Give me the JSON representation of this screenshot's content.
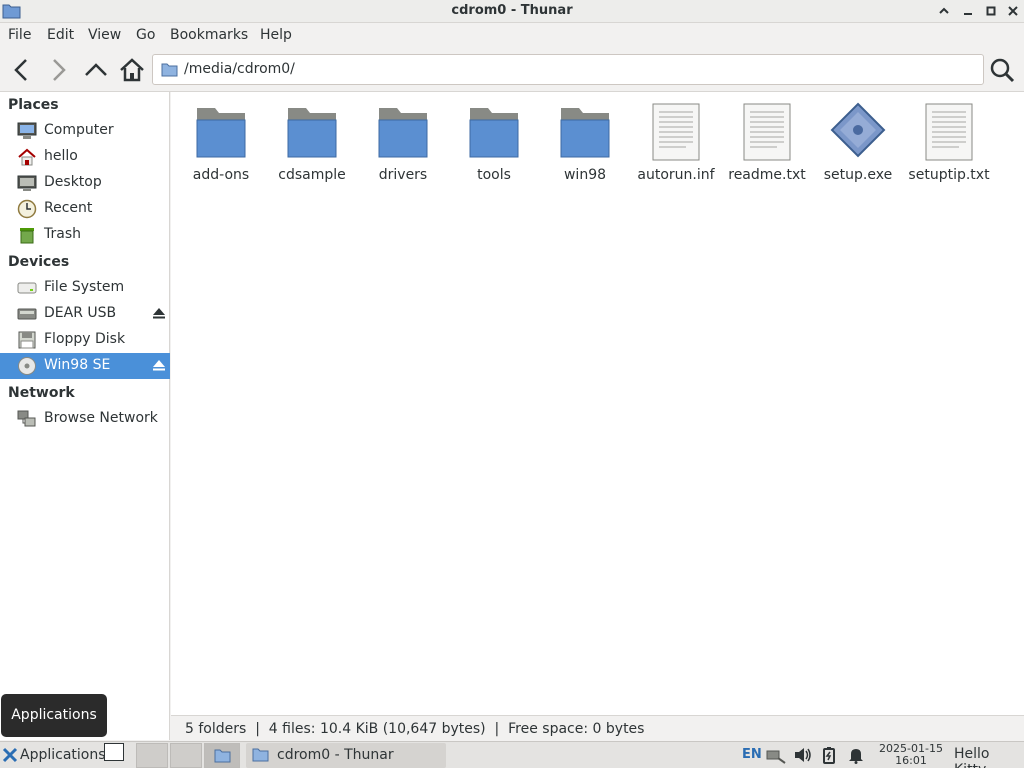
{
  "window": {
    "title": "cdrom0 - Thunar"
  },
  "menu": [
    "File",
    "Edit",
    "View",
    "Go",
    "Bookmarks",
    "Help"
  ],
  "location": {
    "path": "/media/cdrom0/"
  },
  "sidebar": {
    "places_heading": "Places",
    "places": [
      {
        "label": "Computer",
        "icon": "computer-icon"
      },
      {
        "label": "hello",
        "icon": "home-icon"
      },
      {
        "label": "Desktop",
        "icon": "desktop-icon"
      },
      {
        "label": "Recent",
        "icon": "clock-icon"
      },
      {
        "label": "Trash",
        "icon": "trash-icon"
      }
    ],
    "devices_heading": "Devices",
    "devices": [
      {
        "label": "File System",
        "icon": "drive-icon"
      },
      {
        "label": "DEAR USB",
        "icon": "usb-drive-icon"
      },
      {
        "label": "Floppy Disk",
        "icon": "floppy-icon"
      },
      {
        "label": "Win98 SE",
        "icon": "cdrom-icon",
        "selected": true
      }
    ],
    "network_heading": "Network",
    "network": [
      {
        "label": "Browse Network",
        "icon": "network-icon"
      }
    ]
  },
  "files": [
    {
      "name": "add-ons",
      "type": "folder"
    },
    {
      "name": "cdsample",
      "type": "folder"
    },
    {
      "name": "drivers",
      "type": "folder"
    },
    {
      "name": "tools",
      "type": "folder"
    },
    {
      "name": "win98",
      "type": "folder"
    },
    {
      "name": "autorun.inf",
      "type": "text"
    },
    {
      "name": "readme.txt",
      "type": "text"
    },
    {
      "name": "setup.exe",
      "type": "exec"
    },
    {
      "name": "setuptip.txt",
      "type": "text"
    }
  ],
  "status": {
    "text": "5 folders  |  4 files: 10.4 KiB (10,647 bytes)  |  Free space: 0 bytes"
  },
  "tooltip": {
    "text": "Applications"
  },
  "taskbar": {
    "apps_label": "Applications",
    "task_label": "cdrom0 - Thunar",
    "lang": "EN",
    "date": "2025-01-15",
    "time": "16:01",
    "user": "Hello Kitty"
  },
  "colors": {
    "selection": "#4a90d9",
    "folder_blue": "#5b8fd1"
  }
}
